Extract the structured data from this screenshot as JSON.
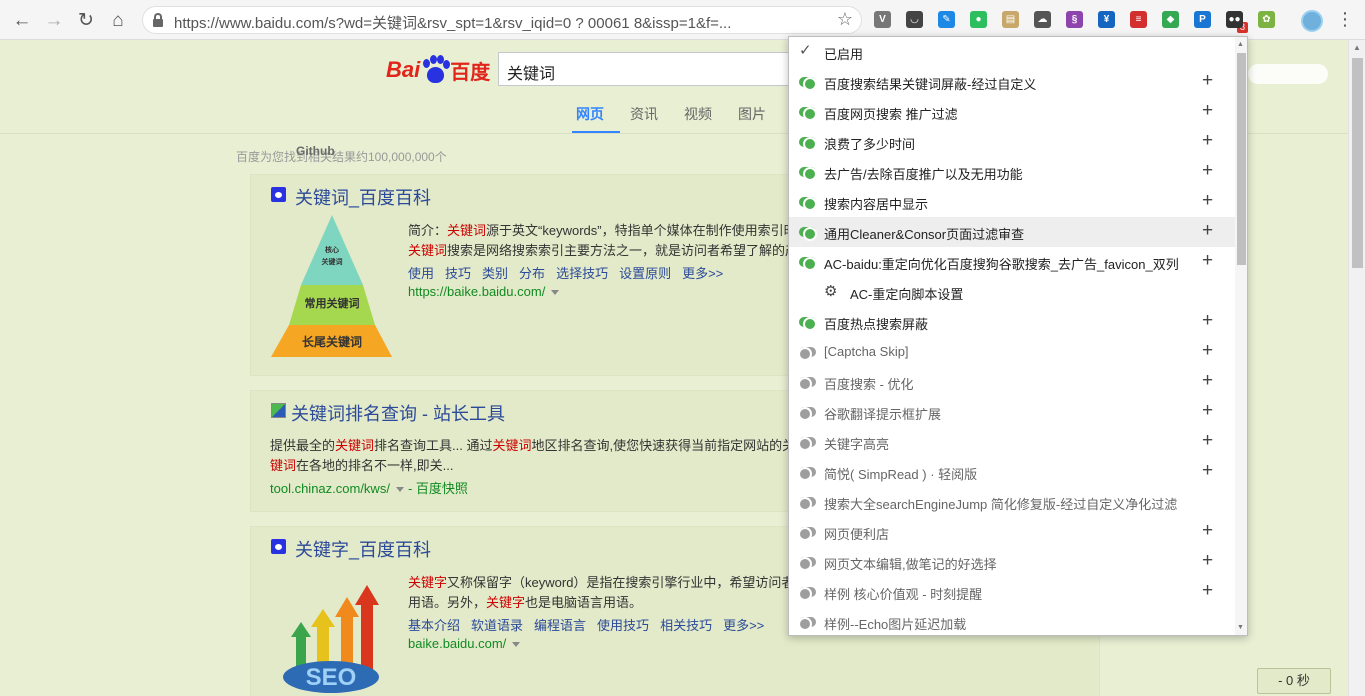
{
  "browser": {
    "url": "https://www.baidu.com/s?wd=关键词&rsv_spt=1&rsv_iqid=0         ?   00061      8&issp=1&f=...",
    "extension_badge": "8",
    "extensions": [
      {
        "name": "v-icon",
        "color": "#777777",
        "glyph": "V"
      },
      {
        "name": "pocket-icon",
        "color": "#444444",
        "glyph": "◡"
      },
      {
        "name": "edge-blue-icon",
        "color": "#1e88e5",
        "glyph": "✎"
      },
      {
        "name": "evernote-icon",
        "color": "#2dbe60",
        "glyph": "●"
      },
      {
        "name": "cookie-jar-icon",
        "color": "#c8a86a",
        "glyph": "▤"
      },
      {
        "name": "cloud-icon",
        "color": "#555555",
        "glyph": "☁"
      },
      {
        "name": "purple-script-icon",
        "color": "#8e44ad",
        "glyph": "§"
      },
      {
        "name": "vue-icon",
        "color": "#1565c0",
        "glyph": "¥"
      },
      {
        "name": "red-note-icon",
        "color": "#d32f2f",
        "glyph": "≡"
      },
      {
        "name": "google-color-icon",
        "color": "#34a853",
        "glyph": "◆"
      },
      {
        "name": "blue-search-icon",
        "color": "#1976d2",
        "glyph": "P"
      },
      {
        "name": "tampermonkey-icon",
        "color": "#333333",
        "glyph": "●●"
      },
      {
        "name": "puzzle-icon",
        "color": "#7cb342",
        "glyph": "✿"
      }
    ]
  },
  "baidu": {
    "logo": {
      "bai": "Bai",
      "du": "du",
      "cn": "百度"
    },
    "query": "关键词",
    "tabs": [
      "网页",
      "资讯",
      "视频",
      "图片"
    ],
    "result_count": "百度为您找到相关结果约100,000,000个",
    "overlay_text": "Github",
    "results": [
      {
        "title": "关键词_百度百科",
        "snippet_line1_prefix": "简介：",
        "snippet_line1_kw": "关键词",
        "snippet_line1_rest": "源于英文“keywords”，特指单个媒体在制作使用索引时",
        "snippet_line2_kw": "关键词",
        "snippet_line2_rest": "搜索是网络搜索索引主要方法之一，就是访问者希望了解的产",
        "sub_links": [
          "使用",
          "技巧",
          "类别",
          "分布",
          "选择技巧",
          "设置原则",
          "更多>>"
        ],
        "url": "https://baike.baidu.com/",
        "pyramid": {
          "top": "核心\n关键词",
          "middle": "常用关键词",
          "bottom": "长尾关键词"
        }
      },
      {
        "title": "关键词排名查询 - 站长工具",
        "snippet_line1_prefix": "提供最全的",
        "snippet_line1_kw": "关键词",
        "snippet_line1_mid": "排名查询工具... 通过",
        "snippet_line1_kw2": "关键词",
        "snippet_line1_rest": "地区排名查询,使您快速获得当前指定网站的关",
        "snippet_line2_kw": "键词",
        "snippet_line2_rest": "在各地的排名不一样,即关...",
        "url": "tool.chinaz.com/kws/",
        "kuaizhao": "- 百度快照"
      },
      {
        "title": "关键字_百度百科",
        "snippet_line1_kw": "关键字",
        "snippet_line1_rest": "又称保留字（keyword）是指在搜索引擎行业中，希望访问者",
        "snippet_line2_prefix": "用语。另外，",
        "snippet_line2_kw": "关键字",
        "snippet_line2_rest": "也是电脑语言用语。",
        "sub_links": [
          "基本介绍",
          "软道语录",
          "编程语言",
          "使用技巧",
          "相关技巧",
          "更多>>"
        ],
        "url": "baike.baidu.com/",
        "image_text": "SEO"
      }
    ]
  },
  "menu": {
    "header": "已启用",
    "items": [
      {
        "label": "百度搜索结果关键词屏蔽-经过自定义",
        "enabled": true,
        "plus": "+"
      },
      {
        "label": "百度网页搜索 推广过滤",
        "enabled": true,
        "plus": "+"
      },
      {
        "label": "浪费了多少时间",
        "enabled": true,
        "plus": "+"
      },
      {
        "label": "去广告/去除百度推广以及无用功能",
        "enabled": true,
        "plus": "+"
      },
      {
        "label": "搜索内容居中显示",
        "enabled": true,
        "plus": "+"
      },
      {
        "label": "通用Cleaner&Consor页面过滤审查",
        "enabled": true,
        "plus": "+",
        "hover": true
      },
      {
        "label": "AC-baidu:重定向优化百度搜狗谷歌搜索_去广告_favicon_双列",
        "enabled": true,
        "plus": "+"
      },
      {
        "label": "AC-重定向脚本设置",
        "sub": true
      },
      {
        "label": "百度热点搜索屏蔽",
        "enabled": true,
        "plus": "+"
      },
      {
        "label": "[Captcha Skip]",
        "enabled": false,
        "plus": "+"
      },
      {
        "label": "百度搜索 - 优化",
        "enabled": false,
        "plus": "+"
      },
      {
        "label": "谷歌翻译提示框扩展",
        "enabled": false,
        "plus": "+"
      },
      {
        "label": "关键字高亮",
        "enabled": false,
        "plus": "+"
      },
      {
        "label": "简悦( SimpRead ) · 轻阅版",
        "enabled": false,
        "plus": "+"
      },
      {
        "label": "搜索大全searchEngineJump 简化修复版-经过自定义净化过滤",
        "enabled": false,
        "plus": ""
      },
      {
        "label": "网页便利店",
        "enabled": false,
        "plus": "+"
      },
      {
        "label": "网页文本编辑,做笔记的好选择",
        "enabled": false,
        "plus": "+"
      },
      {
        "label": "样例 核心价值观 - 时刻提醒",
        "enabled": false,
        "plus": "+"
      },
      {
        "label": "样例--Echo图片延迟加载",
        "enabled": false,
        "plus": ""
      }
    ]
  },
  "timer": "- 0 秒"
}
